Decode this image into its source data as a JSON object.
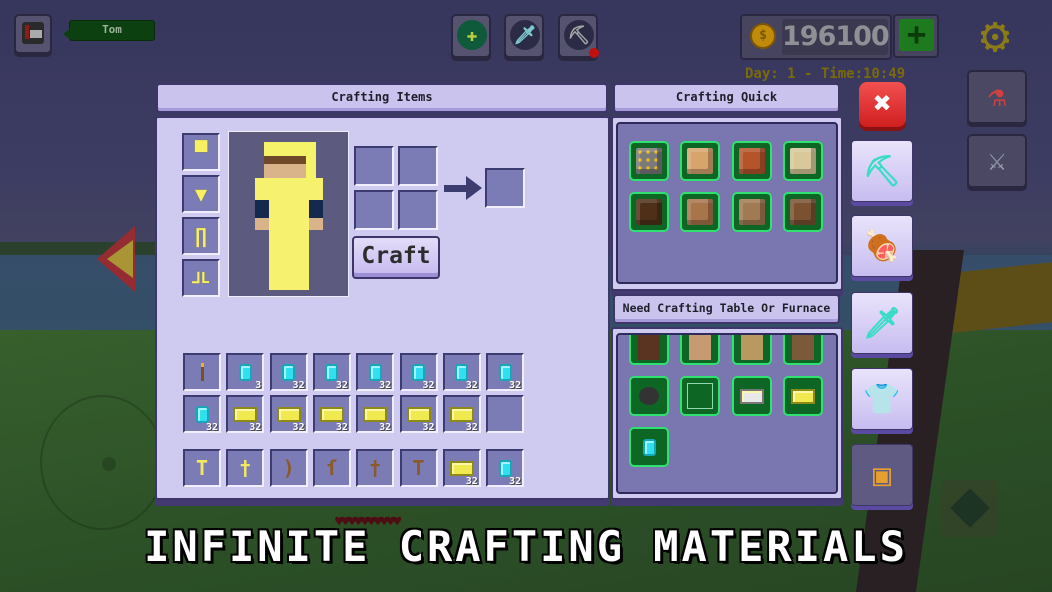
{
  "hud": {
    "player_name": "Tom",
    "coins": "196100",
    "coin_symbol": "$",
    "add_coins_label": "+",
    "day_time": "Day: 1 - Time:10:49",
    "tools": [
      {
        "name": "heal",
        "glyph": "✚",
        "color": "#b8d040"
      },
      {
        "name": "sword",
        "glyph": "🗡",
        "color": "#7fc8d0"
      },
      {
        "name": "pickaxe",
        "glyph": "⛏",
        "color": "#a8a8a8"
      }
    ],
    "side_buttons": [
      {
        "name": "potions",
        "glyph": "⚗"
      },
      {
        "name": "battle",
        "glyph": "⚔"
      }
    ]
  },
  "crafting_items": {
    "title": "Crafting Items",
    "armor_slots": [
      {
        "name": "helmet",
        "glyph": "▀"
      },
      {
        "name": "chestplate",
        "glyph": "▼"
      },
      {
        "name": "leggings",
        "glyph": "∏"
      },
      {
        "name": "boots",
        "glyph": "⅃L"
      }
    ],
    "craft_button": "Craft",
    "inventory_rows": [
      [
        {
          "item": "torch",
          "count": ""
        },
        {
          "item": "diamond",
          "count": "3"
        },
        {
          "item": "diamond",
          "count": "32"
        },
        {
          "item": "diamond",
          "count": "32"
        },
        {
          "item": "diamond",
          "count": "32"
        },
        {
          "item": "diamond",
          "count": "32"
        },
        {
          "item": "diamond",
          "count": "32"
        },
        {
          "item": "diamond",
          "count": "32"
        }
      ],
      [
        {
          "item": "diamond",
          "count": "32"
        },
        {
          "item": "gold_ingot",
          "count": "32"
        },
        {
          "item": "gold_ingot",
          "count": "32"
        },
        {
          "item": "gold_ingot",
          "count": "32"
        },
        {
          "item": "gold_ingot",
          "count": "32"
        },
        {
          "item": "gold_ingot",
          "count": "32"
        },
        {
          "item": "gold_ingot",
          "count": "32"
        },
        {
          "item": "empty",
          "count": ""
        }
      ]
    ],
    "hotbar": [
      {
        "item": "gold_pickaxe",
        "glyph": "T",
        "color": "#f0e860",
        "count": ""
      },
      {
        "item": "gold_sword",
        "glyph": "†",
        "color": "#f0e860",
        "count": ""
      },
      {
        "item": "bow",
        "glyph": ")",
        "color": "#8a5a2a",
        "count": ""
      },
      {
        "item": "fishing_rod",
        "glyph": "ſ",
        "color": "#8a5a2a",
        "count": ""
      },
      {
        "item": "wood_sword",
        "glyph": "†",
        "color": "#8a5a2a",
        "count": ""
      },
      {
        "item": "wood_pickaxe",
        "glyph": "T",
        "color": "#8a5a2a",
        "count": ""
      },
      {
        "item": "gold_ingot",
        "glyph": "",
        "color": "",
        "count": "32"
      },
      {
        "item": "diamond",
        "glyph": "",
        "color": "",
        "count": "32"
      }
    ]
  },
  "crafting_quick": {
    "title": "Crafting Quick",
    "recipes": [
      {
        "item": "gold_ore",
        "color": "#7a7a7a"
      },
      {
        "item": "birch_planks_top",
        "color": "#d7a56c"
      },
      {
        "item": "acacia_planks",
        "color": "#b5542a"
      },
      {
        "item": "birch_planks",
        "color": "#d8c89a"
      },
      {
        "item": "dark_oak_planks",
        "color": "#4e3018"
      },
      {
        "item": "oak_planks",
        "color": "#a8744a"
      },
      {
        "item": "jungle_planks",
        "color": "#a07a52"
      },
      {
        "item": "spruce_planks",
        "color": "#7a5232"
      }
    ]
  },
  "need_table": {
    "title": "Need Crafting Table Or Furnace",
    "recipes": [
      {
        "item": "dark_oak_door",
        "color": "#5a3420"
      },
      {
        "item": "birch_door",
        "color": "#c89a72"
      },
      {
        "item": "oak_door",
        "color": "#b89a60"
      },
      {
        "item": "spruce_door",
        "color": "#7a5a3a"
      },
      {
        "item": "coal",
        "color": "#333333"
      },
      {
        "item": "glass",
        "color": "transparent"
      },
      {
        "item": "iron_ingot",
        "color": "#e8e8e8"
      },
      {
        "item": "gold_ingot",
        "color": "#f0ea50"
      },
      {
        "item": "diamond",
        "color": "#30e0f0"
      }
    ]
  },
  "categories": [
    {
      "name": "tools",
      "glyph": "⛏",
      "color": "#3adcc8"
    },
    {
      "name": "food",
      "glyph": "🍖",
      "color": "#c8703a"
    },
    {
      "name": "weapons",
      "glyph": "🗡",
      "color": "#3adcc8"
    },
    {
      "name": "armor",
      "glyph": "👕",
      "color": "#9fe2f8"
    },
    {
      "name": "storage",
      "glyph": "▣",
      "color": "#e5a030"
    }
  ],
  "close_label": "✖",
  "health_hearts": "♥♥♥♥♥♥♥♥♥♥",
  "banner": "INFINITE CRAFTING MATERIALS"
}
